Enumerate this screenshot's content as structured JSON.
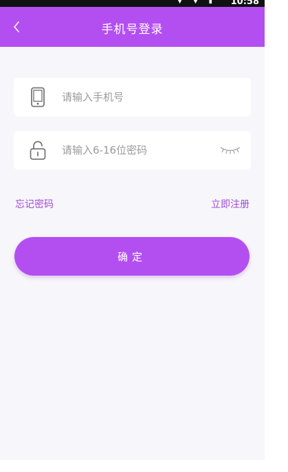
{
  "status_bar": {
    "time": "10:58"
  },
  "header": {
    "title": "手机号登录"
  },
  "phone_field": {
    "placeholder": "请输入手机号",
    "value": ""
  },
  "password_field": {
    "placeholder": "请输入6-16位密码",
    "value": ""
  },
  "links": {
    "forgot_password": "忘记密码",
    "register": "立即注册"
  },
  "confirm_button": {
    "label": "确定"
  },
  "colors": {
    "primary": "#b34ff0",
    "link": "#a04bd6",
    "background": "#f7f6fa",
    "icon_gray": "#777777"
  },
  "icons": [
    "back-icon",
    "phone-icon",
    "lock-icon",
    "eye-closed-icon"
  ]
}
